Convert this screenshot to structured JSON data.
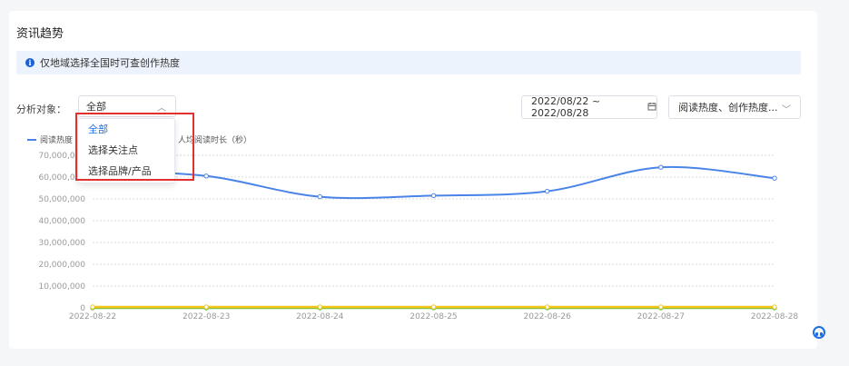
{
  "section_title": "资讯趋势",
  "notice": "仅地域选择全国时可查创作热度",
  "filter": {
    "label": "分析对象：",
    "selected": "全部",
    "options": [
      "全部",
      "选择关注点",
      "选择品牌/产品"
    ]
  },
  "date_range": "2022/08/22 ~ 2022/08/28",
  "metric_select": "阅读热度、创作热度...",
  "legend": {
    "read_heat": "阅读热度",
    "avg_read_time": "人均阅读时长（秒）"
  },
  "colors": {
    "accent": "#1f6fe0",
    "read_heat": "#4a84e8",
    "avg_read_time": "#f0c419",
    "creation": "#6bbf3b"
  },
  "chart_data": {
    "type": "line",
    "x": [
      "2022-08-22",
      "2022-08-23",
      "2022-08-24",
      "2022-08-25",
      "2022-08-26",
      "2022-08-27",
      "2022-08-28"
    ],
    "y_ticks": [
      "0",
      "10,000,000",
      "20,000,000",
      "30,000,000",
      "40,000,000",
      "50,000,000",
      "60,000,000",
      "70,000,000"
    ],
    "ylim": [
      0,
      70000000
    ],
    "grid": true,
    "legend_position": "top-left",
    "series": [
      {
        "name": "阅读热度",
        "values": [
          63000000,
          60500000,
          51000000,
          51500000,
          53500000,
          64500000,
          59500000
        ]
      },
      {
        "name": "人均阅读时长（秒）",
        "values": [
          0,
          0,
          0,
          0,
          0,
          0,
          0
        ]
      },
      {
        "values": [
          0,
          0,
          0,
          0,
          0,
          0,
          0
        ]
      }
    ]
  }
}
